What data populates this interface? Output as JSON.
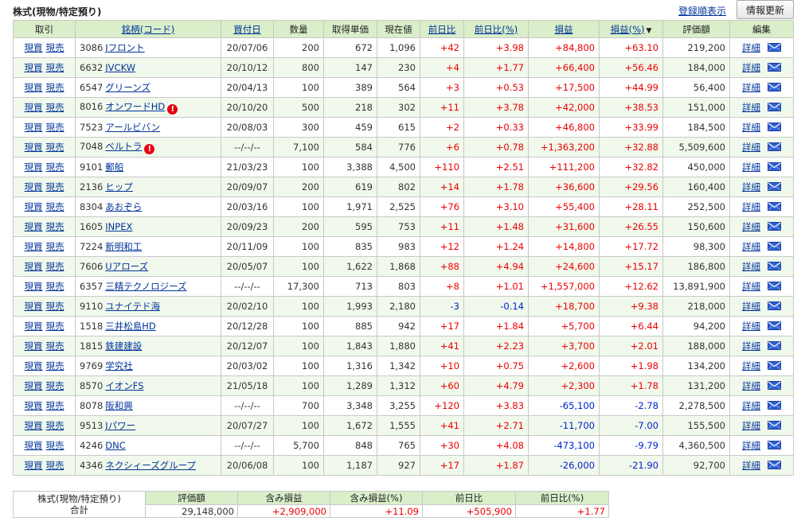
{
  "page": {
    "title": "株式(現物/特定預り)",
    "sort_link": "登録順表示",
    "refresh_button": "情報更新"
  },
  "table": {
    "headers": {
      "trade": "取引",
      "name": "銘柄(コード)",
      "date": "買付日",
      "qty": "数量",
      "cost": "取得単価",
      "price": "現在値",
      "change": "前日比",
      "change_pct": "前日比(%)",
      "pl": "損益",
      "pl_pct": "損益(%)",
      "sort_indicator": "▼",
      "value": "評価額",
      "edit": "編集"
    },
    "buy_label": "現買",
    "sell_label": "現売",
    "detail_label": "詳細",
    "rows": [
      {
        "code": "3086",
        "name": "Jフロント",
        "date": "20/07/06",
        "qty": "200",
        "cost": "672",
        "price": "1,096",
        "change": "+42",
        "change_pct": "+3.98",
        "pl": "+84,800",
        "pl_pct": "+63.10",
        "value": "219,200",
        "alert": false
      },
      {
        "code": "6632",
        "name": "JVCKW",
        "date": "20/10/12",
        "qty": "800",
        "cost": "147",
        "price": "230",
        "change": "+4",
        "change_pct": "+1.77",
        "pl": "+66,400",
        "pl_pct": "+56.46",
        "value": "184,000",
        "alert": false
      },
      {
        "code": "6547",
        "name": "グリーンズ",
        "date": "20/04/13",
        "qty": "100",
        "cost": "389",
        "price": "564",
        "change": "+3",
        "change_pct": "+0.53",
        "pl": "+17,500",
        "pl_pct": "+44.99",
        "value": "56,400",
        "alert": false
      },
      {
        "code": "8016",
        "name": "オンワードHD",
        "date": "20/10/20",
        "qty": "500",
        "cost": "218",
        "price": "302",
        "change": "+11",
        "change_pct": "+3.78",
        "pl": "+42,000",
        "pl_pct": "+38.53",
        "value": "151,000",
        "alert": true
      },
      {
        "code": "7523",
        "name": "アールビバン",
        "date": "20/08/03",
        "qty": "300",
        "cost": "459",
        "price": "615",
        "change": "+2",
        "change_pct": "+0.33",
        "pl": "+46,800",
        "pl_pct": "+33.99",
        "value": "184,500",
        "alert": false
      },
      {
        "code": "7048",
        "name": "ベルトラ",
        "date": "--/--/--",
        "qty": "7,100",
        "cost": "584",
        "price": "776",
        "change": "+6",
        "change_pct": "+0.78",
        "pl": "+1,363,200",
        "pl_pct": "+32.88",
        "value": "5,509,600",
        "alert": true
      },
      {
        "code": "9101",
        "name": "郵船",
        "date": "21/03/23",
        "qty": "100",
        "cost": "3,388",
        "price": "4,500",
        "change": "+110",
        "change_pct": "+2.51",
        "pl": "+111,200",
        "pl_pct": "+32.82",
        "value": "450,000",
        "alert": false
      },
      {
        "code": "2136",
        "name": "ヒップ",
        "date": "20/09/07",
        "qty": "200",
        "cost": "619",
        "price": "802",
        "change": "+14",
        "change_pct": "+1.78",
        "pl": "+36,600",
        "pl_pct": "+29.56",
        "value": "160,400",
        "alert": false
      },
      {
        "code": "8304",
        "name": "あおぞら",
        "date": "20/03/16",
        "qty": "100",
        "cost": "1,971",
        "price": "2,525",
        "change": "+76",
        "change_pct": "+3.10",
        "pl": "+55,400",
        "pl_pct": "+28.11",
        "value": "252,500",
        "alert": false
      },
      {
        "code": "1605",
        "name": "INPEX",
        "date": "20/09/23",
        "qty": "200",
        "cost": "595",
        "price": "753",
        "change": "+11",
        "change_pct": "+1.48",
        "pl": "+31,600",
        "pl_pct": "+26.55",
        "value": "150,600",
        "alert": false
      },
      {
        "code": "7224",
        "name": "新明和工",
        "date": "20/11/09",
        "qty": "100",
        "cost": "835",
        "price": "983",
        "change": "+12",
        "change_pct": "+1.24",
        "pl": "+14,800",
        "pl_pct": "+17.72",
        "value": "98,300",
        "alert": false
      },
      {
        "code": "7606",
        "name": "Uアローズ",
        "date": "20/05/07",
        "qty": "100",
        "cost": "1,622",
        "price": "1,868",
        "change": "+88",
        "change_pct": "+4.94",
        "pl": "+24,600",
        "pl_pct": "+15.17",
        "value": "186,800",
        "alert": false
      },
      {
        "code": "6357",
        "name": "三精テクノロジーズ",
        "date": "--/--/--",
        "qty": "17,300",
        "cost": "713",
        "price": "803",
        "change": "+8",
        "change_pct": "+1.01",
        "pl": "+1,557,000",
        "pl_pct": "+12.62",
        "value": "13,891,900",
        "alert": false
      },
      {
        "code": "9110",
        "name": "ユナイテド海",
        "date": "20/02/10",
        "qty": "100",
        "cost": "1,993",
        "price": "2,180",
        "change": "-3",
        "change_pct": "-0.14",
        "pl": "+18,700",
        "pl_pct": "+9.38",
        "value": "218,000",
        "alert": false
      },
      {
        "code": "1518",
        "name": "三井松島HD",
        "date": "20/12/28",
        "qty": "100",
        "cost": "885",
        "price": "942",
        "change": "+17",
        "change_pct": "+1.84",
        "pl": "+5,700",
        "pl_pct": "+6.44",
        "value": "94,200",
        "alert": false
      },
      {
        "code": "1815",
        "name": "鉄建建設",
        "date": "20/12/07",
        "qty": "100",
        "cost": "1,843",
        "price": "1,880",
        "change": "+41",
        "change_pct": "+2.23",
        "pl": "+3,700",
        "pl_pct": "+2.01",
        "value": "188,000",
        "alert": false
      },
      {
        "code": "9769",
        "name": "学究社",
        "date": "20/03/02",
        "qty": "100",
        "cost": "1,316",
        "price": "1,342",
        "change": "+10",
        "change_pct": "+0.75",
        "pl": "+2,600",
        "pl_pct": "+1.98",
        "value": "134,200",
        "alert": false
      },
      {
        "code": "8570",
        "name": "イオンFS",
        "date": "21/05/18",
        "qty": "100",
        "cost": "1,289",
        "price": "1,312",
        "change": "+60",
        "change_pct": "+4.79",
        "pl": "+2,300",
        "pl_pct": "+1.78",
        "value": "131,200",
        "alert": false
      },
      {
        "code": "8078",
        "name": "阪和興",
        "date": "--/--/--",
        "qty": "700",
        "cost": "3,348",
        "price": "3,255",
        "change": "+120",
        "change_pct": "+3.83",
        "pl": "-65,100",
        "pl_pct": "-2.78",
        "value": "2,278,500",
        "alert": false
      },
      {
        "code": "9513",
        "name": "Jパワー",
        "date": "20/07/27",
        "qty": "100",
        "cost": "1,672",
        "price": "1,555",
        "change": "+41",
        "change_pct": "+2.71",
        "pl": "-11,700",
        "pl_pct": "-7.00",
        "value": "155,500",
        "alert": false
      },
      {
        "code": "4246",
        "name": "DNC",
        "date": "--/--/--",
        "qty": "5,700",
        "cost": "848",
        "price": "765",
        "change": "+30",
        "change_pct": "+4.08",
        "pl": "-473,100",
        "pl_pct": "-9.79",
        "value": "4,360,500",
        "alert": false
      },
      {
        "code": "4346",
        "name": "ネクシィーズグループ",
        "date": "20/06/08",
        "qty": "100",
        "cost": "1,187",
        "price": "927",
        "change": "+17",
        "change_pct": "+1.87",
        "pl": "-26,000",
        "pl_pct": "-21.90",
        "value": "92,700",
        "alert": false
      }
    ]
  },
  "summary": {
    "label_line1": "株式(現物/特定預り)",
    "label_line2": "合計",
    "headers": {
      "value": "評価額",
      "pl": "含み損益",
      "pl_pct": "含み損益(%)",
      "change": "前日比",
      "change_pct": "前日比(%)"
    },
    "values": {
      "value": "29,148,000",
      "pl": "+2,909,000",
      "pl_pct": "+11.09",
      "change": "+505,900",
      "change_pct": "+1.77"
    }
  },
  "colors": {
    "header_bg": "#d9eec9",
    "row_alt_bg": "#f1f9ec",
    "positive": "#ee0000",
    "negative": "#0022cc",
    "link": "#003399",
    "alert": "#e60012"
  },
  "icons": {
    "alert": "alert-icon",
    "mail": "mail-icon"
  }
}
